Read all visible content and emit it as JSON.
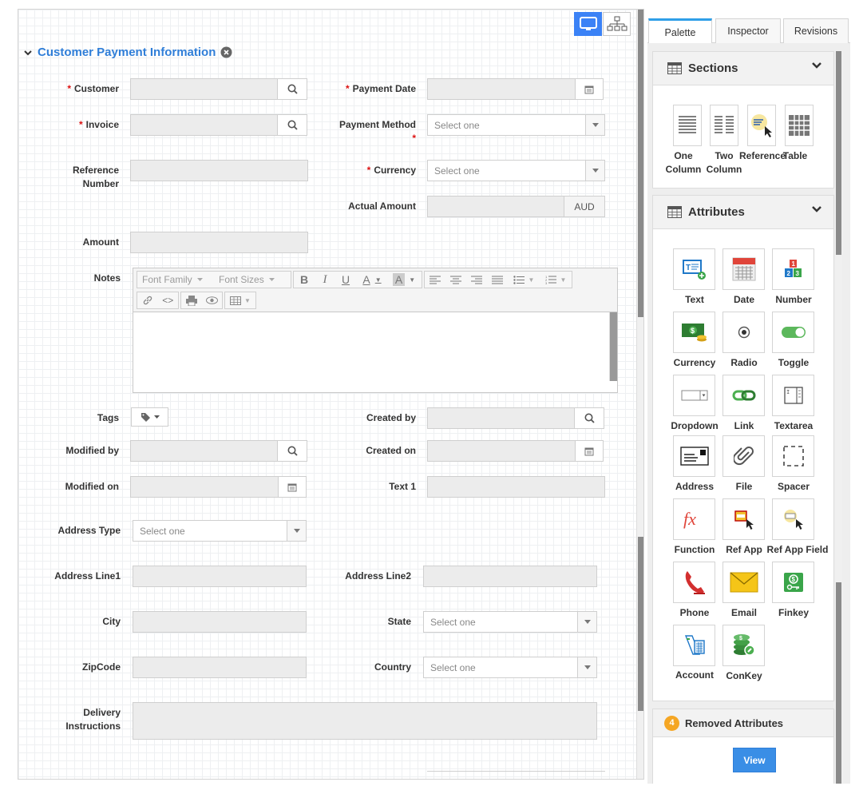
{
  "form": {
    "section_title": "Customer Payment Information",
    "fields": {
      "customer": "Customer",
      "payment_date": "Payment Date",
      "invoice": "Invoice",
      "payment_method": "Payment Method",
      "reference_number_1": "Reference",
      "reference_number_2": "Number",
      "currency": "Currency",
      "actual_amount": "Actual Amount",
      "actual_amount_unit": "AUD",
      "amount": "Amount",
      "notes": "Notes",
      "tags": "Tags",
      "created_by": "Created by",
      "modified_by": "Modified by",
      "created_on": "Created on",
      "modified_on": "Modified on",
      "text1": "Text 1",
      "address_type": "Address Type",
      "address_line1": "Address Line1",
      "address_line2": "Address Line2",
      "city": "City",
      "state": "State",
      "zipcode": "ZipCode",
      "country": "Country",
      "delivery_1": "Delivery",
      "delivery_2": "Instructions"
    },
    "required_mark": "*",
    "select_placeholder": "Select one",
    "editor": {
      "font_family": "Font Family",
      "font_sizes": "Font Sizes"
    }
  },
  "panel": {
    "tabs": [
      "Palette",
      "Inspector",
      "Revisions"
    ],
    "sections": {
      "title": "Sections",
      "items": [
        {
          "line1": "One",
          "line2": "Column"
        },
        {
          "line1": "Two",
          "line2": "Column"
        },
        {
          "line1": "Reference",
          "line2": ""
        },
        {
          "line1": "Table",
          "line2": ""
        }
      ]
    },
    "attributes": {
      "title": "Attributes",
      "items": [
        "Text",
        "Date",
        "Number",
        "Currency",
        "Radio",
        "Toggle",
        "Dropdown",
        "Link",
        "Textarea",
        "Address",
        "File",
        "Spacer",
        "Function",
        "Ref App",
        "Ref App Field",
        "Phone",
        "Email",
        "Finkey",
        "Account",
        "ConKey"
      ]
    },
    "removed": {
      "count": "4",
      "title": "Removed Attributes",
      "view_label": "View"
    }
  },
  "colors": {
    "accent": "#2f7ed8",
    "required": "#dd1111",
    "active_tab": "#2f9fe8",
    "badge": "#f5a623"
  }
}
